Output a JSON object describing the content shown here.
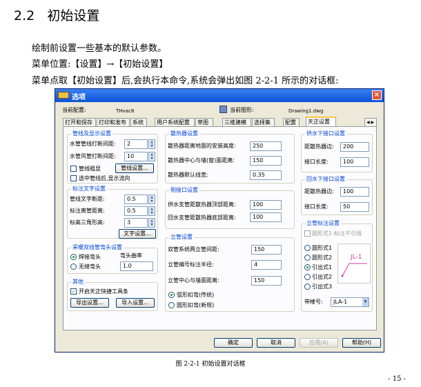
{
  "heading": {
    "num": "2.2",
    "title": "初始设置"
  },
  "paragraphs": [
    "绘制前设置一些基本的默认参数。",
    "菜单位置:【设置】→【初始设置】",
    "菜单点取【初始设置】后,会执行本命令,系统会弹出如图 2-2-1 所示的对话框:"
  ],
  "dialog": {
    "title": "选项",
    "close": "×",
    "current_profile_label": "当前配置:",
    "current_profile_value": "THvac8",
    "current_drawing_label": "当前图形:",
    "current_drawing_value": "Drawing1.dwg",
    "tabs": [
      "打开和保存",
      "打印和发布",
      "系统",
      "用户系统配置",
      "草图",
      "三维建模",
      "选择集",
      "配置",
      "天正设置"
    ],
    "tab_scroll": "◀ ▶",
    "pipe_display": {
      "title": "管线及显示设置",
      "water_label": "水管管线打断间距:",
      "water_value": "2",
      "wind_label": "水管风管打断间距:",
      "wind_value": "10",
      "bold_label": "管线粗显",
      "pipe_setting_btn": "管线设置...",
      "select_show_label": "选中管线后,显示流向"
    },
    "text_settings": {
      "title": "标注文字设置",
      "font_label": "管线文字断距:",
      "font_value": "0.5",
      "dist_label": "标注离管距离:",
      "dist_value": "0.5",
      "tri_label": "标高三角形高:",
      "tri_value": "3",
      "btn": "文字设置..."
    },
    "elbow": {
      "title": "采暖双线管弯头设置",
      "weld_label": "焊接弯头",
      "curve_label": "弯头曲率",
      "seamless_label": "无缝弯头",
      "curve_value": "1.0"
    },
    "other": {
      "title": "其他",
      "toolbar_label": "开启天正快捷工具条",
      "export_btn": "导出设置...",
      "import_btn": "导入设置..."
    },
    "radiator": {
      "title": "散热器设置",
      "height_label": "散热器距离地面的安装高度:",
      "height_value": "250",
      "wall_label": "散热器中心与墙(窗)面距离:",
      "wall_value": "150",
      "num_label": "散热器默认线宽:",
      "num_value": "0.35"
    },
    "side_inlet": {
      "title": "侧接口设置",
      "top_label": "供水支管距散热器顶部距离:",
      "top_value": "100",
      "bottom_label": "回水支管距散热器底部距离:",
      "bottom_value": "100"
    },
    "riser": {
      "title": "立管设置",
      "dist_label": "双管系统两立管间距:",
      "dist_value": "150",
      "radius_label": "立管编号标注半径:",
      "radius_value": "4",
      "wall_label": "立管中心与墙面距离:",
      "wall_value": "150",
      "arc_label": "弧形扣弯(传统)",
      "rect_label": "圆形扣弯(新规)"
    },
    "supply_down": {
      "title": "供水下接口设置",
      "dist_label": "距散热器边:",
      "dist_value": "200",
      "len_label": "接口长度:",
      "len_value": "100"
    },
    "return_down": {
      "title": "回水下接口设置",
      "dist_label": "距散热器边:",
      "dist_value": "100",
      "len_label": "接口长度:",
      "len_value": "50"
    },
    "riser_label": {
      "title": "立管标注设置",
      "check_label": "圆形式1-标注不引线",
      "opt1": "圆形式1",
      "opt2": "圆形式2",
      "opt3": "引出式1",
      "opt4": "引出式2",
      "opt5": "引出式3",
      "preview_text": "JL-1",
      "prefix_label": "带楼号:",
      "prefix_value": "JLA-1"
    },
    "buttons": {
      "ok": "确定",
      "cancel": "取消",
      "apply": "应用(A)",
      "help": "帮助(H)"
    }
  },
  "caption": "图 2-2-1   初始设置对话框",
  "page_number": "- 15 -"
}
